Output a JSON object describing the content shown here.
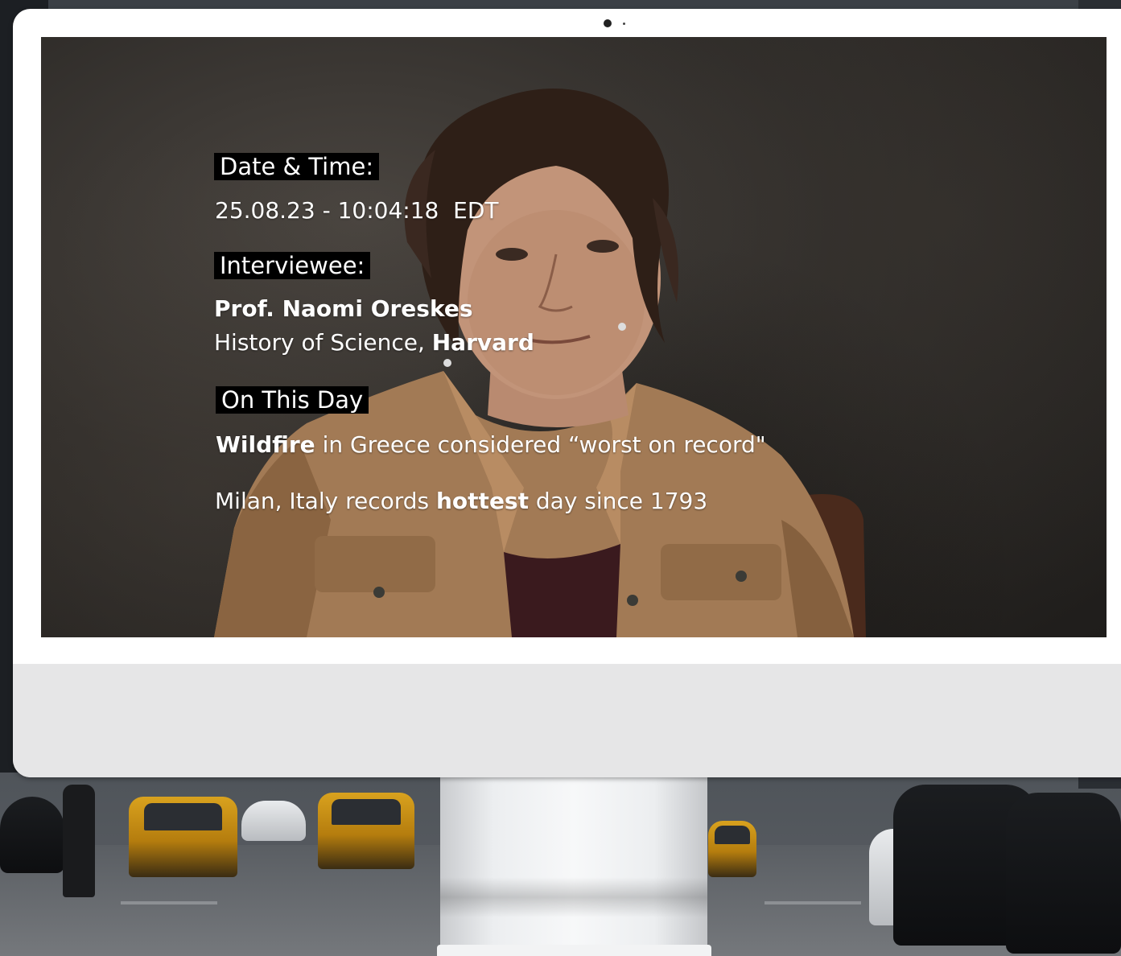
{
  "screen": {
    "date_time_label": "Date & Time:",
    "date_time_value": "25.08.23 - 10:04:18",
    "timezone": "EDT",
    "interviewee_label": "Interviewee:",
    "interviewee_name": "Prof. Naomi Oreskes",
    "interviewee_dept": "History of Science,",
    "interviewee_org": "Harvard",
    "on_this_day_label": "On This Day",
    "event1_bold": "Wildfire",
    "event1_rest": " in Greece considered “worst on record\"",
    "event2_start": "Milan, Italy records ",
    "event2_bold": "hottest",
    "event2_end": "  day since 1793"
  },
  "colors": {
    "tag_background": "#000000",
    "text": "#ffffff",
    "monitor_bezel": "#ffffff",
    "monitor_chin": "#e6e6e7",
    "jacket": "#a27a55",
    "hair": "#2e1f17"
  }
}
